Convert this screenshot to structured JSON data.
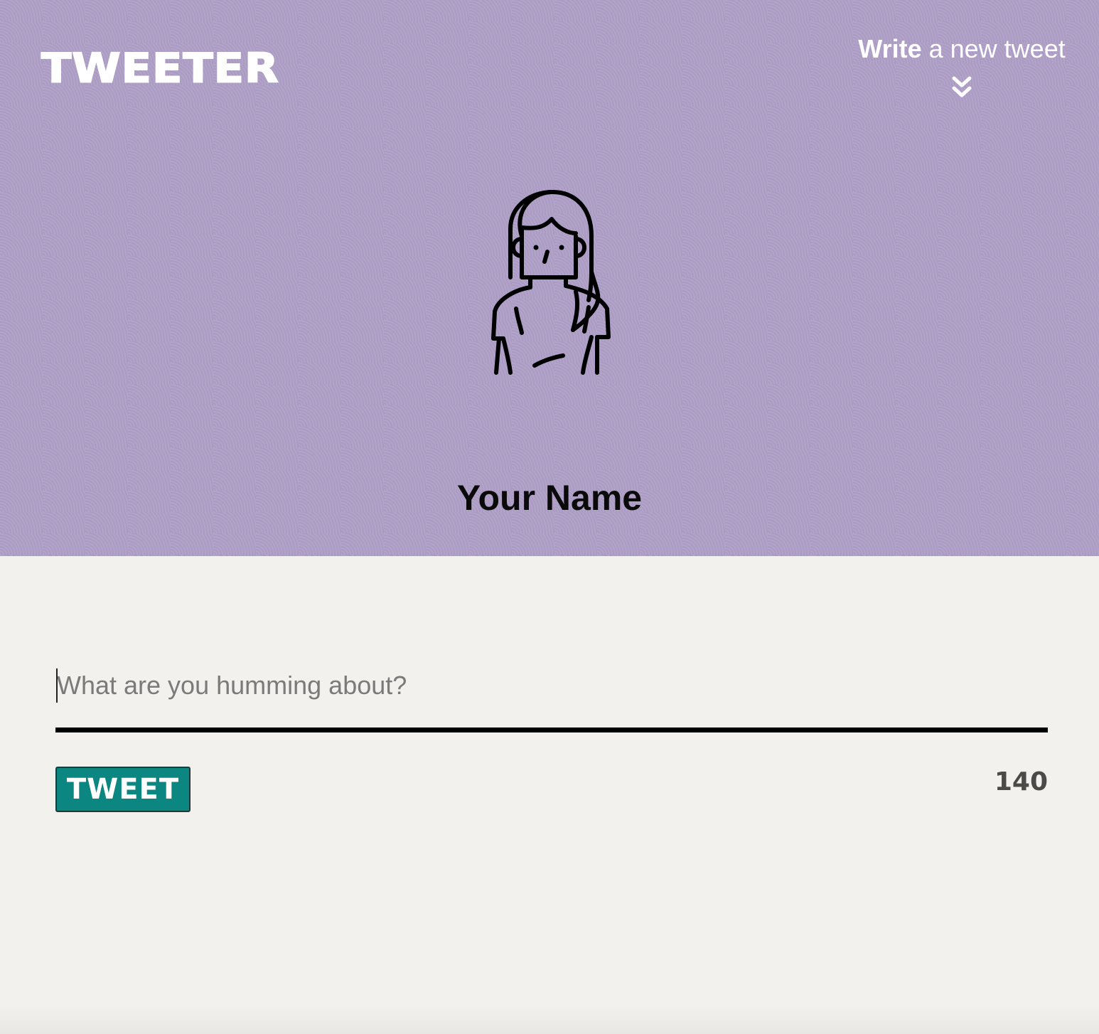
{
  "header": {
    "logo": "TWEETER",
    "compose_toggle": {
      "bold": "Write",
      "rest": " a new tweet",
      "icon": "double-chevron-down-icon"
    },
    "avatar_icon": "user-avatar-icon",
    "user_name": "Your Name",
    "background_color": "#ae9ec6"
  },
  "composer": {
    "placeholder": "What are you humming about?",
    "value": "",
    "submit_label": "TWEET",
    "char_counter": "140",
    "button_color": "#0b8680"
  }
}
